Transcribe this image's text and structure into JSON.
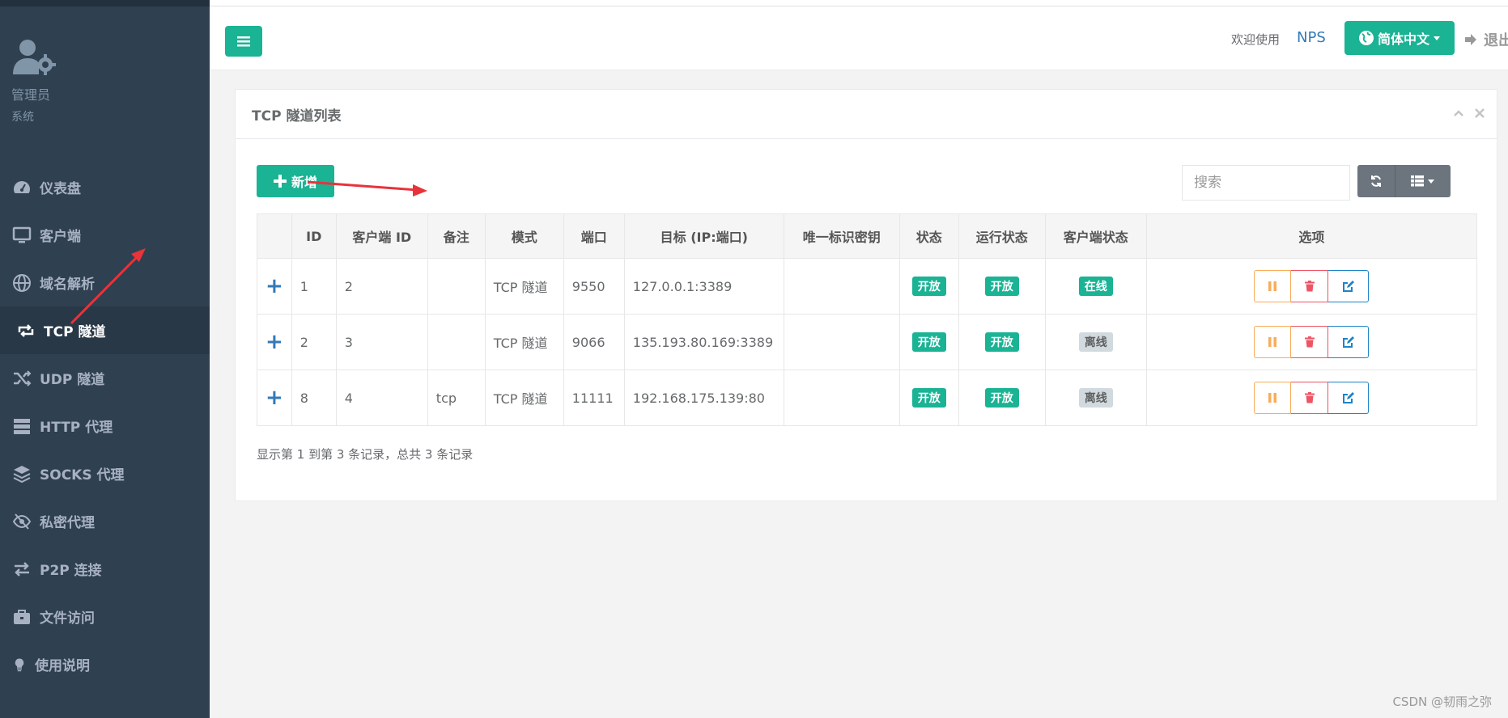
{
  "sidebar": {
    "profile": {
      "name": "管理员",
      "role": "系统"
    },
    "items": [
      {
        "label": "仪表盘",
        "icon": "dashboard-icon"
      },
      {
        "label": "客户端",
        "icon": "desktop-icon"
      },
      {
        "label": "域名解析",
        "icon": "globe-icon"
      },
      {
        "label": "TCP 隧道",
        "icon": "retweet-icon",
        "active": true
      },
      {
        "label": "UDP 隧道",
        "icon": "random-icon"
      },
      {
        "label": "HTTP 代理",
        "icon": "server-icon"
      },
      {
        "label": "SOCKS 代理",
        "icon": "layers-icon"
      },
      {
        "label": "私密代理",
        "icon": "eye-slash-icon"
      },
      {
        "label": "P2P 连接",
        "icon": "exchange-icon"
      },
      {
        "label": "文件访问",
        "icon": "briefcase-icon"
      },
      {
        "label": "使用说明",
        "icon": "lightbulb-icon"
      }
    ]
  },
  "header": {
    "welcome": "欢迎使用",
    "brand": "NPS",
    "language": "简体中文",
    "logout": "退出"
  },
  "panel": {
    "title": "TCP 隧道列表",
    "add_label": "新增",
    "search_placeholder": "搜索",
    "columns": [
      "ID",
      "客户端 ID",
      "备注",
      "模式",
      "端口",
      "目标 (IP:端口)",
      "唯一标识密钥",
      "状态",
      "运行状态",
      "客户端状态",
      "选项"
    ],
    "rows": [
      {
        "id": "1",
        "client_id": "2",
        "remark": "",
        "mode": "TCP 隧道",
        "port": "9550",
        "target": "127.0.0.1:3389",
        "key": "",
        "status": "开放",
        "run_status": "开放",
        "client_status": "在线",
        "client_online": true
      },
      {
        "id": "2",
        "client_id": "3",
        "remark": "",
        "mode": "TCP 隧道",
        "port": "9066",
        "target": "135.193.80.169:3389",
        "key": "",
        "status": "开放",
        "run_status": "开放",
        "client_status": "离线",
        "client_online": false
      },
      {
        "id": "8",
        "client_id": "4",
        "remark": "tcp",
        "mode": "TCP 隧道",
        "port": "11111",
        "target": "192.168.175.139:80",
        "key": "",
        "status": "开放",
        "run_status": "开放",
        "client_status": "离线",
        "client_online": false
      }
    ],
    "summary": "显示第 1 到第 3 条记录，总共 3 条记录"
  },
  "watermark": "CSDN @韧雨之弥",
  "colors": {
    "accent": "#1ab394",
    "sidebar": "#2f4050",
    "warning": "#f8ac59",
    "danger": "#ed5565",
    "primary": "#1c84c6",
    "annotation": "#e8333a"
  }
}
